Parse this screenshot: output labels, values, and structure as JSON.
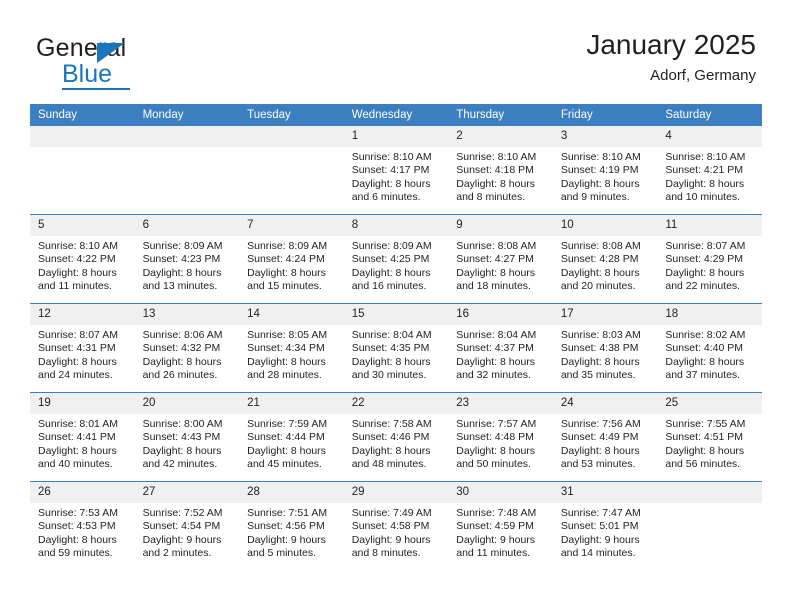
{
  "brand": {
    "name_dark": "General",
    "name_blue": "Blue",
    "triangle_icon": "blue-triangle-icon",
    "accent_color": "#1b75bb"
  },
  "header": {
    "title": "January 2025",
    "subtitle": "Adorf, Germany"
  },
  "colors": {
    "header_row": "#3c7fc0",
    "daynum_strip": "#f0f0f0",
    "text": "#231f20"
  },
  "weekday_headers": [
    "Sunday",
    "Monday",
    "Tuesday",
    "Wednesday",
    "Thursday",
    "Friday",
    "Saturday"
  ],
  "weeks": [
    [
      {
        "day": "",
        "empty": true
      },
      {
        "day": "",
        "empty": true
      },
      {
        "day": "",
        "empty": true
      },
      {
        "day": "1",
        "sunrise": "Sunrise: 8:10 AM",
        "sunset": "Sunset: 4:17 PM",
        "daylight1": "Daylight: 8 hours",
        "daylight2": "and 6 minutes."
      },
      {
        "day": "2",
        "sunrise": "Sunrise: 8:10 AM",
        "sunset": "Sunset: 4:18 PM",
        "daylight1": "Daylight: 8 hours",
        "daylight2": "and 8 minutes."
      },
      {
        "day": "3",
        "sunrise": "Sunrise: 8:10 AM",
        "sunset": "Sunset: 4:19 PM",
        "daylight1": "Daylight: 8 hours",
        "daylight2": "and 9 minutes."
      },
      {
        "day": "4",
        "sunrise": "Sunrise: 8:10 AM",
        "sunset": "Sunset: 4:21 PM",
        "daylight1": "Daylight: 8 hours",
        "daylight2": "and 10 minutes."
      }
    ],
    [
      {
        "day": "5",
        "sunrise": "Sunrise: 8:10 AM",
        "sunset": "Sunset: 4:22 PM",
        "daylight1": "Daylight: 8 hours",
        "daylight2": "and 11 minutes."
      },
      {
        "day": "6",
        "sunrise": "Sunrise: 8:09 AM",
        "sunset": "Sunset: 4:23 PM",
        "daylight1": "Daylight: 8 hours",
        "daylight2": "and 13 minutes."
      },
      {
        "day": "7",
        "sunrise": "Sunrise: 8:09 AM",
        "sunset": "Sunset: 4:24 PM",
        "daylight1": "Daylight: 8 hours",
        "daylight2": "and 15 minutes."
      },
      {
        "day": "8",
        "sunrise": "Sunrise: 8:09 AM",
        "sunset": "Sunset: 4:25 PM",
        "daylight1": "Daylight: 8 hours",
        "daylight2": "and 16 minutes."
      },
      {
        "day": "9",
        "sunrise": "Sunrise: 8:08 AM",
        "sunset": "Sunset: 4:27 PM",
        "daylight1": "Daylight: 8 hours",
        "daylight2": "and 18 minutes."
      },
      {
        "day": "10",
        "sunrise": "Sunrise: 8:08 AM",
        "sunset": "Sunset: 4:28 PM",
        "daylight1": "Daylight: 8 hours",
        "daylight2": "and 20 minutes."
      },
      {
        "day": "11",
        "sunrise": "Sunrise: 8:07 AM",
        "sunset": "Sunset: 4:29 PM",
        "daylight1": "Daylight: 8 hours",
        "daylight2": "and 22 minutes."
      }
    ],
    [
      {
        "day": "12",
        "sunrise": "Sunrise: 8:07 AM",
        "sunset": "Sunset: 4:31 PM",
        "daylight1": "Daylight: 8 hours",
        "daylight2": "and 24 minutes."
      },
      {
        "day": "13",
        "sunrise": "Sunrise: 8:06 AM",
        "sunset": "Sunset: 4:32 PM",
        "daylight1": "Daylight: 8 hours",
        "daylight2": "and 26 minutes."
      },
      {
        "day": "14",
        "sunrise": "Sunrise: 8:05 AM",
        "sunset": "Sunset: 4:34 PM",
        "daylight1": "Daylight: 8 hours",
        "daylight2": "and 28 minutes."
      },
      {
        "day": "15",
        "sunrise": "Sunrise: 8:04 AM",
        "sunset": "Sunset: 4:35 PM",
        "daylight1": "Daylight: 8 hours",
        "daylight2": "and 30 minutes."
      },
      {
        "day": "16",
        "sunrise": "Sunrise: 8:04 AM",
        "sunset": "Sunset: 4:37 PM",
        "daylight1": "Daylight: 8 hours",
        "daylight2": "and 32 minutes."
      },
      {
        "day": "17",
        "sunrise": "Sunrise: 8:03 AM",
        "sunset": "Sunset: 4:38 PM",
        "daylight1": "Daylight: 8 hours",
        "daylight2": "and 35 minutes."
      },
      {
        "day": "18",
        "sunrise": "Sunrise: 8:02 AM",
        "sunset": "Sunset: 4:40 PM",
        "daylight1": "Daylight: 8 hours",
        "daylight2": "and 37 minutes."
      }
    ],
    [
      {
        "day": "19",
        "sunrise": "Sunrise: 8:01 AM",
        "sunset": "Sunset: 4:41 PM",
        "daylight1": "Daylight: 8 hours",
        "daylight2": "and 40 minutes."
      },
      {
        "day": "20",
        "sunrise": "Sunrise: 8:00 AM",
        "sunset": "Sunset: 4:43 PM",
        "daylight1": "Daylight: 8 hours",
        "daylight2": "and 42 minutes."
      },
      {
        "day": "21",
        "sunrise": "Sunrise: 7:59 AM",
        "sunset": "Sunset: 4:44 PM",
        "daylight1": "Daylight: 8 hours",
        "daylight2": "and 45 minutes."
      },
      {
        "day": "22",
        "sunrise": "Sunrise: 7:58 AM",
        "sunset": "Sunset: 4:46 PM",
        "daylight1": "Daylight: 8 hours",
        "daylight2": "and 48 minutes."
      },
      {
        "day": "23",
        "sunrise": "Sunrise: 7:57 AM",
        "sunset": "Sunset: 4:48 PM",
        "daylight1": "Daylight: 8 hours",
        "daylight2": "and 50 minutes."
      },
      {
        "day": "24",
        "sunrise": "Sunrise: 7:56 AM",
        "sunset": "Sunset: 4:49 PM",
        "daylight1": "Daylight: 8 hours",
        "daylight2": "and 53 minutes."
      },
      {
        "day": "25",
        "sunrise": "Sunrise: 7:55 AM",
        "sunset": "Sunset: 4:51 PM",
        "daylight1": "Daylight: 8 hours",
        "daylight2": "and 56 minutes."
      }
    ],
    [
      {
        "day": "26",
        "sunrise": "Sunrise: 7:53 AM",
        "sunset": "Sunset: 4:53 PM",
        "daylight1": "Daylight: 8 hours",
        "daylight2": "and 59 minutes."
      },
      {
        "day": "27",
        "sunrise": "Sunrise: 7:52 AM",
        "sunset": "Sunset: 4:54 PM",
        "daylight1": "Daylight: 9 hours",
        "daylight2": "and 2 minutes."
      },
      {
        "day": "28",
        "sunrise": "Sunrise: 7:51 AM",
        "sunset": "Sunset: 4:56 PM",
        "daylight1": "Daylight: 9 hours",
        "daylight2": "and 5 minutes."
      },
      {
        "day": "29",
        "sunrise": "Sunrise: 7:49 AM",
        "sunset": "Sunset: 4:58 PM",
        "daylight1": "Daylight: 9 hours",
        "daylight2": "and 8 minutes."
      },
      {
        "day": "30",
        "sunrise": "Sunrise: 7:48 AM",
        "sunset": "Sunset: 4:59 PM",
        "daylight1": "Daylight: 9 hours",
        "daylight2": "and 11 minutes."
      },
      {
        "day": "31",
        "sunrise": "Sunrise: 7:47 AM",
        "sunset": "Sunset: 5:01 PM",
        "daylight1": "Daylight: 9 hours",
        "daylight2": "and 14 minutes."
      },
      {
        "day": "",
        "empty": true
      }
    ]
  ]
}
